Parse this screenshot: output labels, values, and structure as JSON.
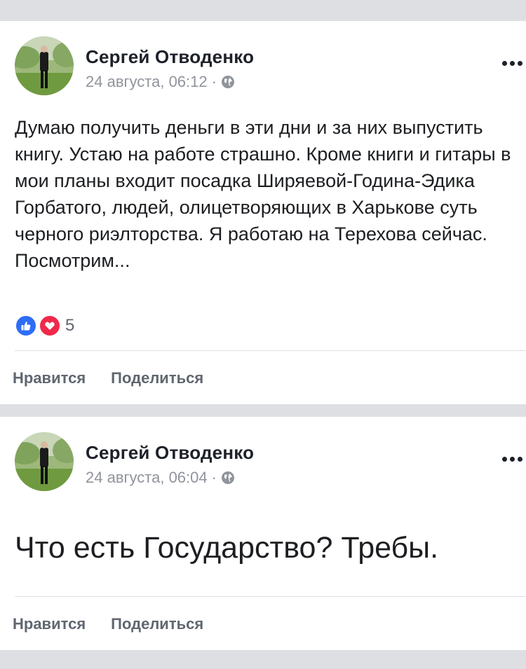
{
  "posts": [
    {
      "author": "Сергей Отводенко",
      "timestamp": "24 августа, 06:12",
      "separator": "·",
      "privacy_icon": "globe-icon",
      "text": "Думаю получить деньги в эти дни и за них выпустить книгу. Устаю на работе страшно. Кроме книги и гитары в мои планы входит посадка Ширяевой-Година-Эдика Горбатого, людей, олицетворяющих в Харькове суть черного риэлторства. Я работаю на Терехова сейчас. Посмотрим...",
      "reactions": {
        "icons": [
          "like-icon",
          "love-icon"
        ],
        "count": "5"
      },
      "actions": {
        "like": "Нравится",
        "share": "Поделиться"
      }
    },
    {
      "author": "Сергей Отводенко",
      "timestamp": "24 августа, 06:04",
      "separator": "·",
      "privacy_icon": "globe-icon",
      "text": "Что есть Государство? Требы.",
      "actions": {
        "like": "Нравится",
        "share": "Поделиться"
      }
    }
  ],
  "colors": {
    "background": "#dddfe2",
    "card": "#ffffff",
    "like_blue": "#2e6df6",
    "love_red": "#f0284a",
    "secondary_text": "#90949c"
  }
}
